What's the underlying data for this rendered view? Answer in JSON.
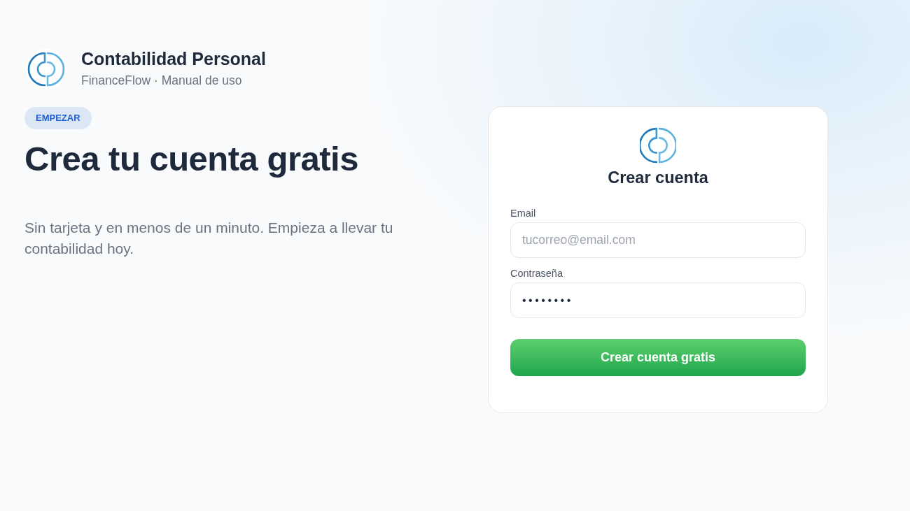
{
  "brand": {
    "title": "Contabilidad Personal",
    "subtitle": "FinanceFlow · Manual de uso"
  },
  "hero": {
    "badge": "EMPEZAR",
    "heading": "Crea tu cuenta gratis",
    "description": "Sin tarjeta y en menos de un minuto. Empieza a llevar tu contabilidad hoy."
  },
  "form": {
    "title": "Crear cuenta",
    "fields": [
      {
        "label": "Email",
        "placeholder": "tucorreo@email.com"
      },
      {
        "label": "Contraseña",
        "value": "••••••••"
      }
    ],
    "submit": "Crear cuenta gratis"
  }
}
